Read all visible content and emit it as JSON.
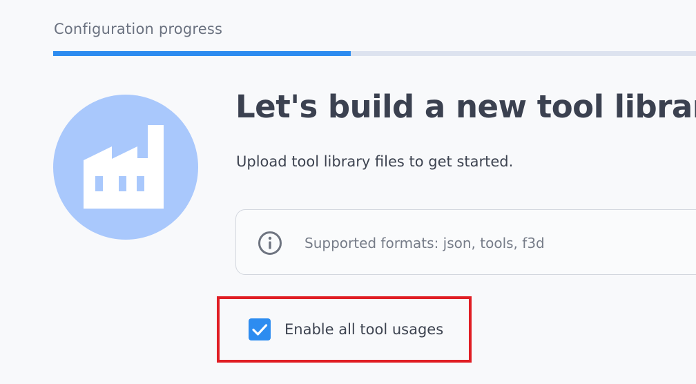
{
  "progress": {
    "label": "Configuration progress",
    "fraction": 0.463
  },
  "hero": {
    "icon": "factory-icon",
    "circle_color": "#a9c8fc"
  },
  "main": {
    "title": "Let's build a new tool library",
    "subtitle": "Upload tool library files to get started.",
    "info": {
      "icon": "info-icon",
      "text": "Supported formats: json, tools, f3d"
    }
  },
  "options": {
    "enable_all_usages": {
      "label": "Enable all tool usages",
      "checked": true
    }
  },
  "colors": {
    "accent": "#2d8cf0",
    "highlight": "#e01e24"
  }
}
